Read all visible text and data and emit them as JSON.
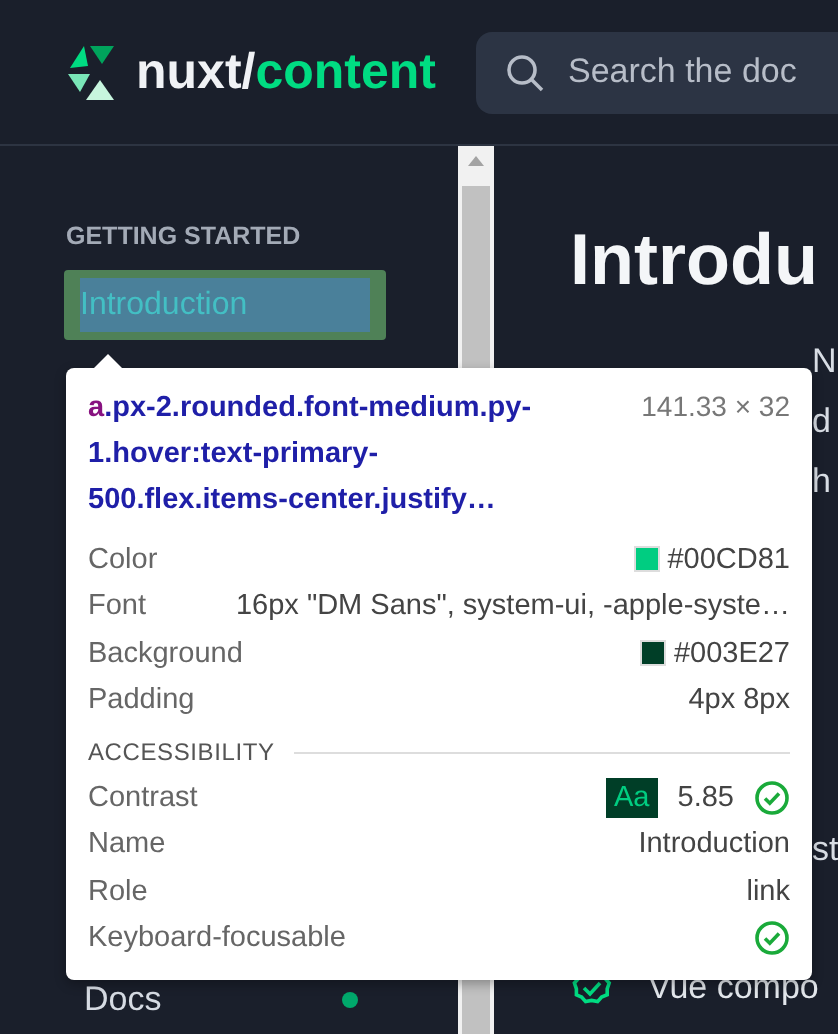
{
  "header": {
    "logo_prefix": "nuxt/",
    "logo_accent": "content",
    "search": {
      "placeholder": "Search the doc"
    }
  },
  "sidebar": {
    "section_title": "GETTING STARTED",
    "items": [
      {
        "label": "Introduction",
        "selected": true,
        "highlighted": true
      },
      {
        "label": "Docs",
        "selected": false,
        "highlighted": false,
        "color": "#00a86b"
      }
    ]
  },
  "main": {
    "title": "Introdu",
    "lines": [
      "N",
      "d",
      "h",
      "st"
    ],
    "feature": {
      "label": "Vue compo"
    }
  },
  "inspector": {
    "tag": "a",
    "classes": ".px-2.rounded.font-medium.py-1.hover:text-primary-500.flex.items-center.justify…",
    "size": "141.33 × 32",
    "rows": [
      {
        "kind": "swatch",
        "label": "Color",
        "value": "#00CD81",
        "color": "#00cd81"
      },
      {
        "kind": "text",
        "label": "Font",
        "value": "16px \"DM Sans\", system-ui, -apple-syste…"
      },
      {
        "kind": "swatch",
        "label": "Background",
        "value": "#003E27",
        "color": "#003e27"
      },
      {
        "kind": "text",
        "label": "Padding",
        "value": "4px 8px"
      }
    ],
    "section_title": "ACCESSIBILITY",
    "accessibility": [
      {
        "kind": "contrast",
        "label": "Contrast",
        "badge": "Aa",
        "value": "5.85",
        "passed": true
      },
      {
        "kind": "text",
        "label": "Name",
        "value": "Introduction"
      },
      {
        "kind": "text",
        "label": "Role",
        "value": "link"
      },
      {
        "kind": "check",
        "label": "Keyboard-focusable",
        "passed": true
      }
    ]
  }
}
